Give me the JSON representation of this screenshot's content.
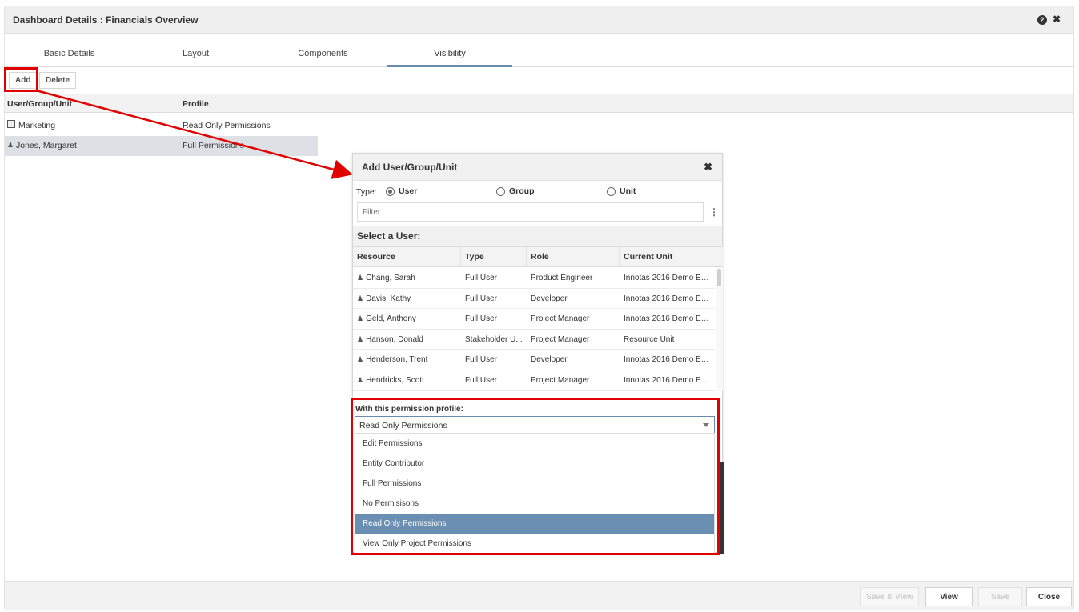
{
  "window": {
    "title": "Dashboard Details : Financials Overview",
    "help_icon": "?",
    "close_icon": "✖"
  },
  "tabs": [
    {
      "label": "Basic Details"
    },
    {
      "label": "Layout"
    },
    {
      "label": "Components"
    },
    {
      "label": "Visibility",
      "active": true
    }
  ],
  "toolbar": {
    "add_label": "Add",
    "delete_label": "Delete"
  },
  "grid": {
    "headers": [
      "User/Group/Unit",
      "Profile"
    ],
    "rows": [
      {
        "icon": "group-icon",
        "name": "Marketing",
        "profile": "Read Only Permissions"
      },
      {
        "icon": "person-icon",
        "name": "Jones, Margaret",
        "profile": "Full Permissions",
        "selected": true
      }
    ]
  },
  "footer": {
    "save_view": "Save & View",
    "view": "View",
    "save": "Save",
    "close": "Close"
  },
  "dialog": {
    "title": "Add User/Group/Unit",
    "close_icon": "✖",
    "type_label": "Type:",
    "types": [
      {
        "label": "User",
        "checked": true
      },
      {
        "label": "Group",
        "checked": false
      },
      {
        "label": "Unit",
        "checked": false
      }
    ],
    "filter_placeholder": "Filter",
    "kebab_icon": "⋮",
    "select_header": "Select a User:",
    "table": {
      "headers": [
        "Resource",
        "Type",
        "Role",
        "Current Unit"
      ],
      "rows": [
        {
          "resource": "Chang, Sarah",
          "type": "Full User",
          "role": "Product Engineer",
          "unit": "Innotas 2016 Demo En..."
        },
        {
          "resource": "Davis, Kathy",
          "type": "Full User",
          "role": "Developer",
          "unit": "Innotas 2016 Demo En..."
        },
        {
          "resource": "Geld, Anthony",
          "type": "Full User",
          "role": "Project Manager",
          "unit": "Innotas 2016 Demo En..."
        },
        {
          "resource": "Hanson, Donald",
          "type": "Stakeholder U...",
          "role": "Project Manager",
          "unit": "Resource Unit"
        },
        {
          "resource": "Henderson, Trent",
          "type": "Full User",
          "role": "Developer",
          "unit": "Innotas 2016 Demo En..."
        },
        {
          "resource": "Hendricks, Scott",
          "type": "Full User",
          "role": "Project Manager",
          "unit": "Innotas 2016 Demo En..."
        }
      ]
    },
    "permission": {
      "label": "With this permission profile:",
      "selected": "Read Only Permissions",
      "options": [
        "Edit Permissions",
        "Entity Contributor",
        "Full Permissions",
        "No Permisisons",
        "Read Only Permissions",
        "View Only Project Permissions"
      ],
      "selected_index": 4
    }
  },
  "colors": {
    "accent": "#6a8cac",
    "highlight": "#6b8fb3",
    "annotation": "#e00000",
    "selected_row": "#dde1e6"
  }
}
